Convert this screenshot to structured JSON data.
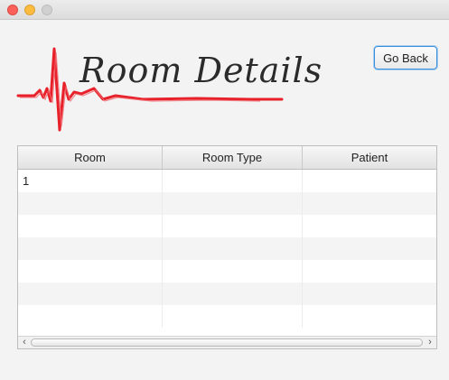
{
  "window": {
    "controls": [
      "close-button",
      "minimize-button",
      "maximize-button"
    ]
  },
  "header": {
    "title": "Room Details",
    "logo_icon": "heartbeat-line-icon",
    "accent_color": "#e8202a"
  },
  "actions": {
    "go_back_label": "Go Back"
  },
  "table": {
    "columns": [
      "Room",
      "Room Type",
      "Patient"
    ],
    "rows": [
      [
        "1",
        "",
        ""
      ],
      [
        "",
        "",
        ""
      ],
      [
        "",
        "",
        ""
      ],
      [
        "",
        "",
        ""
      ],
      [
        "",
        "",
        ""
      ],
      [
        "",
        "",
        ""
      ],
      [
        "",
        "",
        ""
      ]
    ]
  },
  "scrollbar": {
    "left_icon": "‹",
    "right_icon": "›"
  }
}
